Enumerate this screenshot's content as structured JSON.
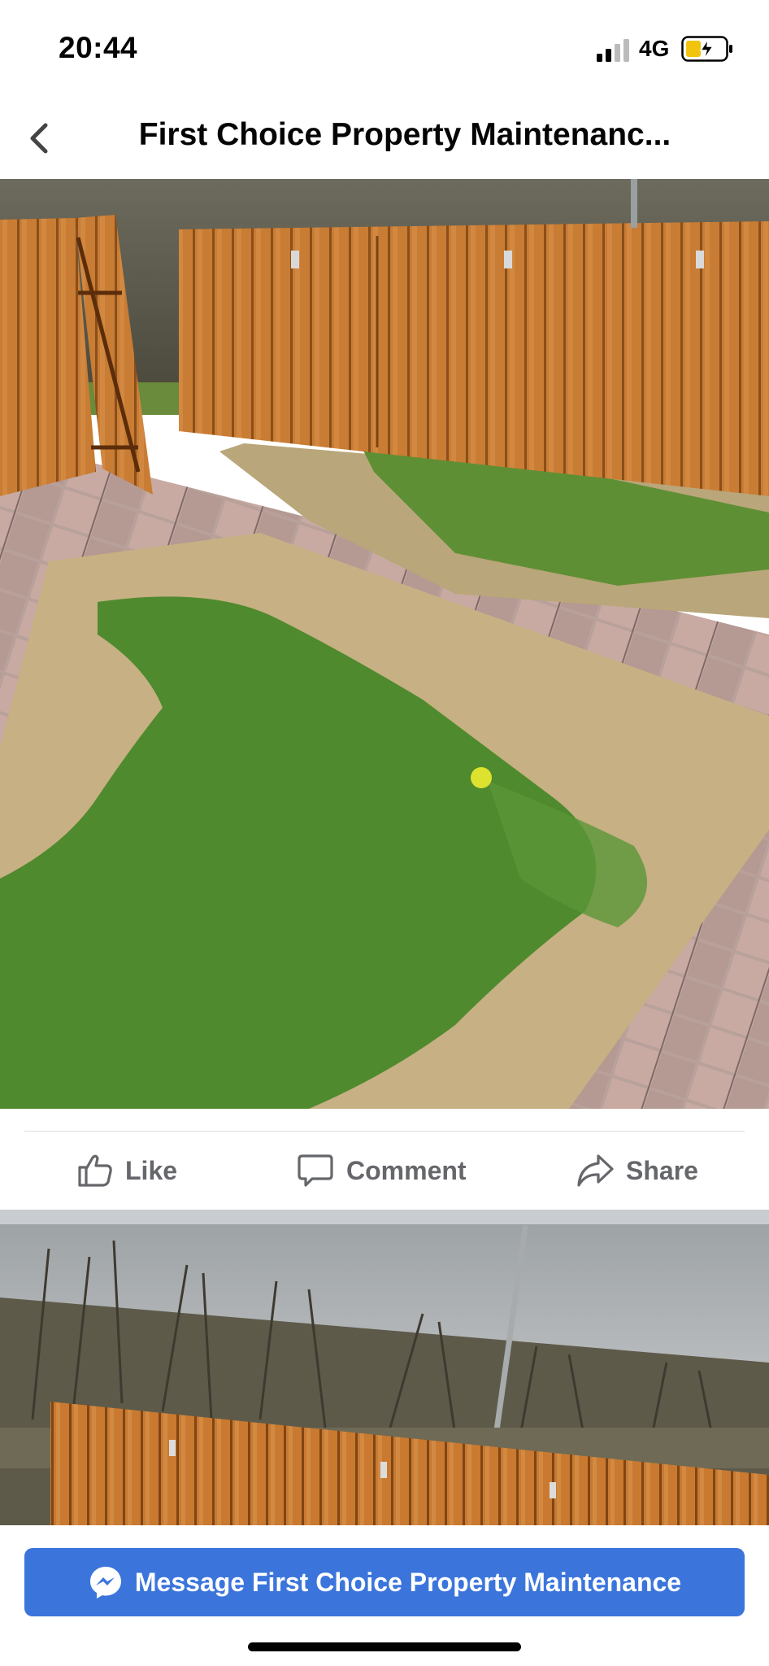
{
  "status": {
    "time": "20:44",
    "network": "4G"
  },
  "nav": {
    "title": "First Choice Property Maintenanc..."
  },
  "actions": {
    "like": "Like",
    "comment": "Comment",
    "share": "Share"
  },
  "message_button": {
    "label": "Message First Choice Property Maintenance"
  },
  "icons": [
    "signal-icon",
    "battery-charging-icon",
    "back-chevron-icon",
    "like-thumb-icon",
    "comment-bubble-icon",
    "share-arrow-icon",
    "messenger-icon"
  ],
  "colors": {
    "accent": "#3b75dc",
    "action_text": "#65676b",
    "separator": "#c9ccd1"
  }
}
